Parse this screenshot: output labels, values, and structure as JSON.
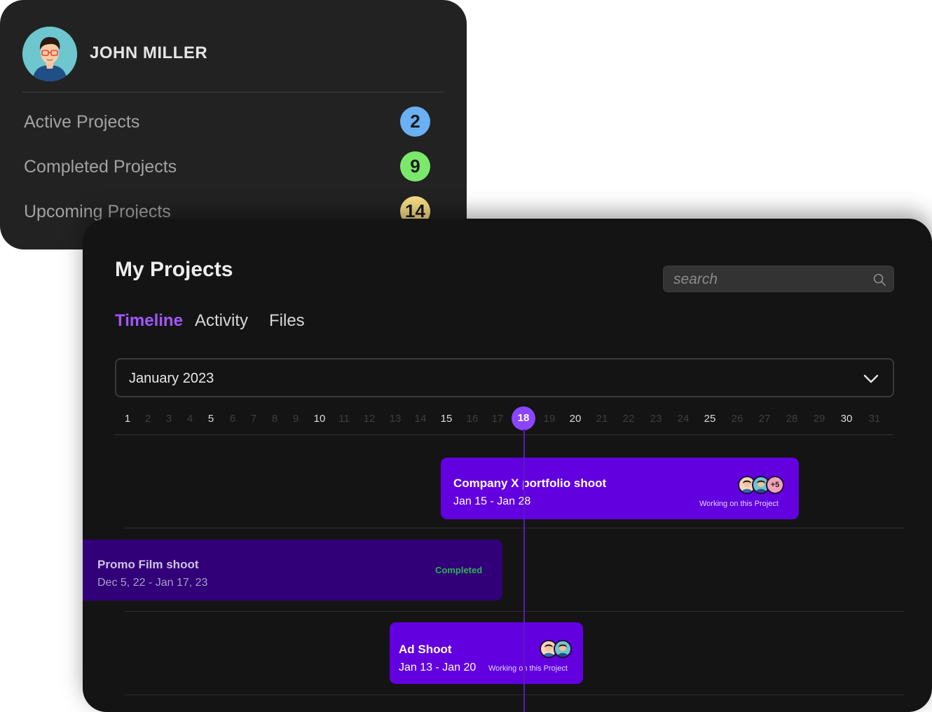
{
  "profile": {
    "name": "JOHN MILLER",
    "stats": [
      {
        "label": "Active Projects",
        "count": "2",
        "color": "#6ab0f3"
      },
      {
        "label": "Completed Projects",
        "count": "9",
        "color": "#7ae86a"
      },
      {
        "label": "Upcoming Projects",
        "count": "14",
        "color": "#f5dc85"
      }
    ]
  },
  "projects_panel": {
    "title": "My Projects",
    "search": {
      "placeholder": "search"
    },
    "tabs": [
      {
        "label": "Timeline",
        "active": true
      },
      {
        "label": "Activity",
        "active": false
      },
      {
        "label": "Files",
        "active": false
      }
    ],
    "month": "January 2023",
    "days": [
      "1",
      "2",
      "3",
      "4",
      "5",
      "6",
      "7",
      "8",
      "9",
      "10",
      "11",
      "12",
      "13",
      "14",
      "15",
      "16",
      "17",
      "18",
      "19",
      "20",
      "21",
      "22",
      "23",
      "24",
      "25",
      "26",
      "27",
      "28",
      "29",
      "30",
      "31"
    ],
    "today": "18",
    "projects": [
      {
        "title": "Company X portfolio shoot",
        "dates": "Jan 15 - Jan 28",
        "note": "Working on this Project",
        "extra_members": "+5",
        "color": "#6200e0"
      },
      {
        "title": "Promo Film shoot",
        "dates": "Dec 5, 22 - Jan 17, 23",
        "status": "Completed",
        "color": "#310078"
      },
      {
        "title": "Ad Shoot",
        "dates": "Jan 13 - Jan 20",
        "note": "Working on this Project",
        "color": "#6200e0"
      }
    ]
  }
}
